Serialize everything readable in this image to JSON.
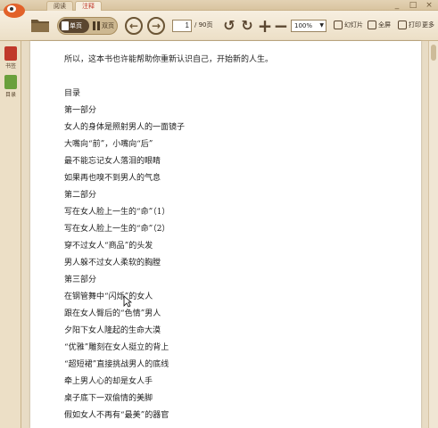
{
  "tabs": [
    "阅读",
    "注释"
  ],
  "window_controls": [
    "_",
    "□",
    "×"
  ],
  "toolbar": {
    "single_page_label": "单页",
    "double_page_label": "双页",
    "current_page": "1",
    "total_pages": "/ 90页",
    "zoom": "100%",
    "slideshow_label": "幻灯片",
    "fullscreen_label": "全屏",
    "print_label": "打印",
    "more_label": "更多"
  },
  "sidebar": {
    "items": [
      {
        "label": "书签",
        "icon": "bookmark-icon",
        "color": "#c0392b"
      },
      {
        "label": "目录",
        "icon": "toc-icon",
        "color": "#6aa03c"
      }
    ]
  },
  "document": {
    "lines": [
      "所以，这本书也许能帮助你重新认识自己，开始新的人生。",
      "目录",
      "第一部分",
      "女人的身体是照射男人的一面镜子",
      "大嘴向“前”，小嘴向“后”",
      "最不能忘记女人落泪的眼睛",
      "如果再也嗅不到男人的气息",
      "第二部分",
      "写在女人脸上一生的“命”（1）",
      "写在女人脸上一生的“命”（2）",
      "穿不过女人“商品”的头发",
      "男人躲不过女人柔软的胸膛",
      "第三部分",
      "在钢管舞中“闪烁”的女人",
      "跟在女人臀后的“色情”男人",
      "夕阳下女人隆起的生命大漠",
      "“优雅”雕刻在女人挺立的背上",
      "“超短裙”直接挑战男人的底线",
      "牵上男人心的却是女人手",
      "桌子底下一双偷情的美脚",
      "假如女人不再有“最美”的器官"
    ]
  }
}
